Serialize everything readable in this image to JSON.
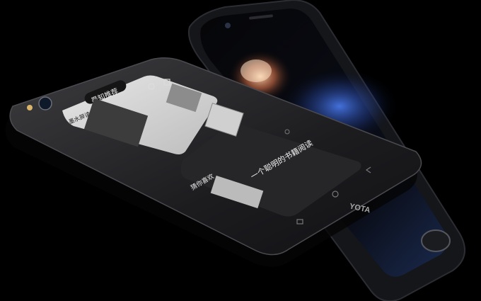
{
  "scene": {
    "background": "#000000",
    "accent_particles": "#d98a5c",
    "accent_glow": "#3f6fd8"
  },
  "front_phone": {
    "brand_label": "YOTA",
    "color": "#1a1a1c",
    "eink_screen": {
      "header_tab": "墨知推荐",
      "subheader": "墨水屏读书",
      "section_label": "猜你喜欢",
      "article_title": "一个聪明的书籍阅读",
      "icons": [
        "search-icon",
        "menu-icon",
        "back-icon",
        "home-icon",
        "recent-apps-icon"
      ]
    }
  },
  "back_phone": {
    "color": "#0f1013",
    "screen_content": "particle-wallpaper",
    "icons": [
      "fingerprint-home-button",
      "front-camera",
      "earpiece-speaker"
    ]
  }
}
